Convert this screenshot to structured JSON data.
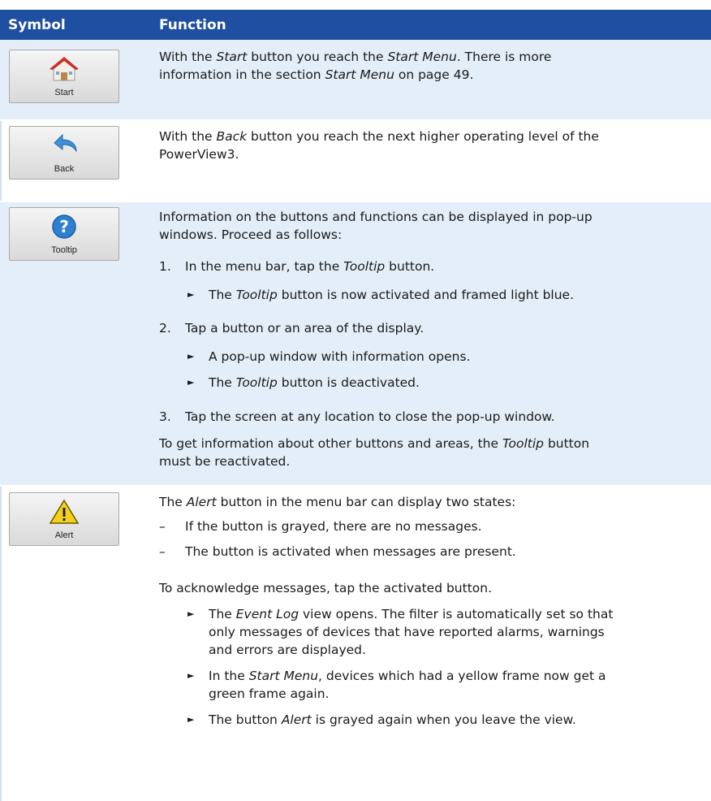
{
  "header": {
    "col_symbol": "Symbol",
    "col_function": "Function"
  },
  "rows": {
    "start": {
      "button_label": "Start",
      "text_a": "With the ",
      "text_b": "Start",
      "text_c": " button you reach the ",
      "text_d": "Start Menu",
      "text_e": ". There is more",
      "text_f": "information in the section ",
      "text_g": "Start Menu",
      "text_h": " on page 49."
    },
    "back": {
      "button_label": "Back",
      "text_a": "With the ",
      "text_b": "Back",
      "text_c": " button you reach the next higher operating level of the",
      "text_d": "PowerView3."
    },
    "tooltip": {
      "button_label": "Tooltip",
      "intro_1": "Information on the buttons and functions can be displayed in pop-up",
      "intro_2": "windows. Proceed as follows:",
      "step1_num": "1.",
      "step1_a": "In the menu bar, tap the ",
      "step1_b": "Tooltip",
      "step1_c": " button.",
      "step1_res_a": "The ",
      "step1_res_b": "Tooltip",
      "step1_res_c": " button is now activated and framed light blue.",
      "step2_num": "2.",
      "step2": "Tap a button or an area of the display.",
      "step2_res1": "A pop-up window with information opens.",
      "step2_res2_a": "The ",
      "step2_res2_b": "Tooltip",
      "step2_res2_c": " button is deactivated.",
      "step3_num": "3.",
      "step3": "Tap the screen at any location to close the pop-up window.",
      "outro_1a": "To get information about other buttons and areas, the ",
      "outro_1b": "Tooltip",
      "outro_1c": " button",
      "outro_2": "must be reactivated."
    },
    "alert": {
      "button_label": "Alert",
      "intro_a": "The ",
      "intro_b": "Alert",
      "intro_c": " button in the menu bar can display two states:",
      "dash1": "If the button is grayed, there are no messages.",
      "dash2": "The button is activated when messages are present.",
      "ack": "To acknowledge messages, tap the activated button.",
      "res1_1a": "The ",
      "res1_1b": "Event Log",
      "res1_1c": " view opens. The filter is automatically set so that",
      "res1_2": "only messages of devices that have reported alarms, warnings",
      "res1_3": "and errors are displayed.",
      "res2_1a": "In the ",
      "res2_1b": "Start Menu",
      "res2_1c": ", devices which had a yellow frame now get a",
      "res2_2": "green frame again.",
      "res3_a": "The button ",
      "res3_b": "Alert",
      "res3_c": " is grayed again when you leave the view."
    }
  },
  "glyphs": {
    "arrow": "►",
    "dash": "–"
  },
  "colors": {
    "header_bg": "#1f4fa0",
    "row_shade": "#e4eef8"
  }
}
